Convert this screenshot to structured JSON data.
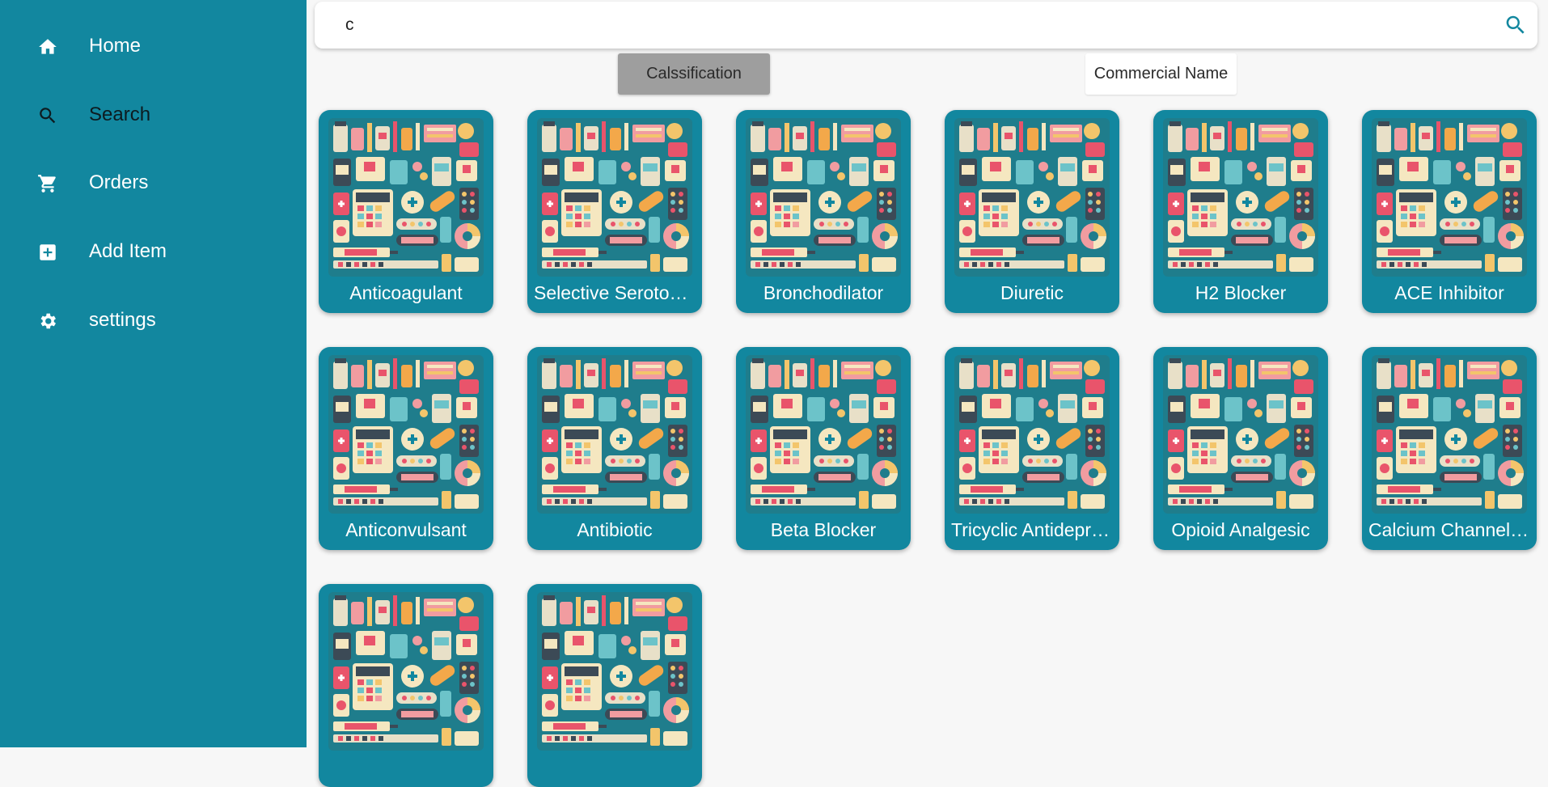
{
  "sidebar": {
    "bg_color": "#12879f",
    "items": [
      {
        "label": "Home",
        "icon": "home-icon"
      },
      {
        "label": "Search",
        "icon": "search-icon",
        "active": true
      },
      {
        "label": "Orders",
        "icon": "cart-icon"
      },
      {
        "label": "Add Item",
        "icon": "add-box-icon"
      },
      {
        "label": "settings",
        "icon": "gear-icon"
      }
    ]
  },
  "search": {
    "value": "c",
    "button_icon": "search-icon"
  },
  "filters": {
    "classification_label": "Calssification",
    "commercial_label": "Commercial Name",
    "selected": "classification"
  },
  "cards": [
    {
      "label": "Anticoagulant"
    },
    {
      "label": "Selective Serotonin Reuptake Inhibitor"
    },
    {
      "label": "Bronchodilator"
    },
    {
      "label": "Diuretic"
    },
    {
      "label": "H2 Blocker"
    },
    {
      "label": "ACE Inhibitor"
    },
    {
      "label": "Anticonvulsant"
    },
    {
      "label": "Antibiotic"
    },
    {
      "label": "Beta Blocker"
    },
    {
      "label": "Tricyclic Antidepressant"
    },
    {
      "label": "Opioid Analgesic"
    },
    {
      "label": "Calcium Channel Blocker"
    },
    {
      "label": ""
    },
    {
      "label": ""
    }
  ],
  "card_image": {
    "icon": "medicine-collage-image",
    "bg_color": "#1f7d8c"
  }
}
